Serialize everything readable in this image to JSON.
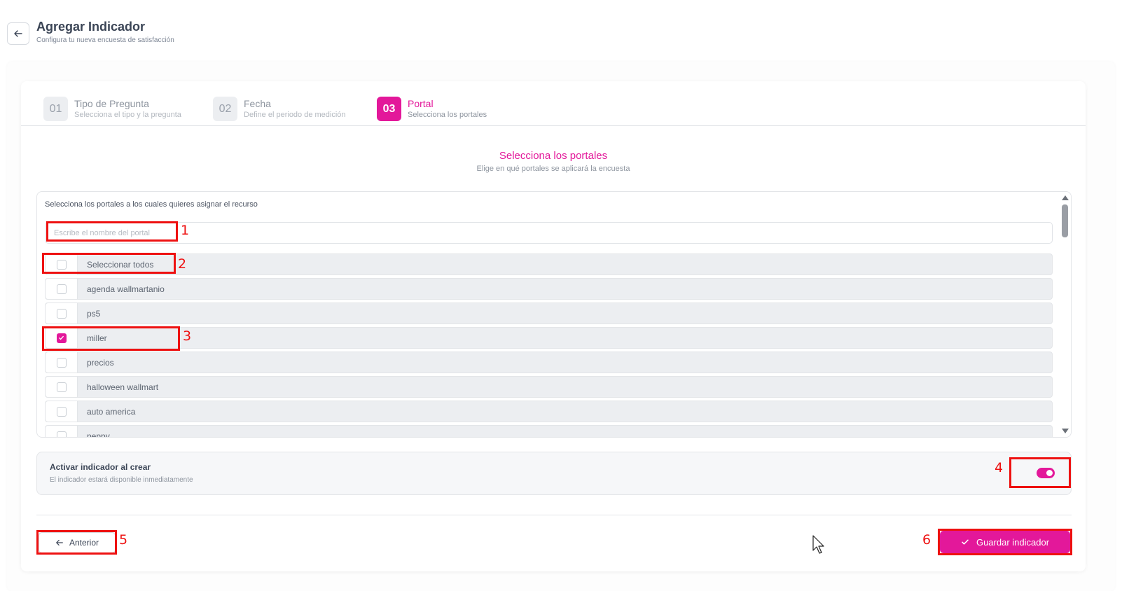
{
  "header": {
    "title": "Agregar Indicador",
    "subtitle": "Configura tu nueva encuesta de satisfacción"
  },
  "stepper": [
    {
      "number": "01",
      "title": "Tipo de Pregunta",
      "description": "Selecciona el tipo y la pregunta",
      "active": false
    },
    {
      "number": "02",
      "title": "Fecha",
      "description": "Define el periodo de medición",
      "active": false
    },
    {
      "number": "03",
      "title": "Portal",
      "description": "Selecciona los portales",
      "active": true
    }
  ],
  "section": {
    "title": "Selecciona los portales",
    "subtitle": "Elige en qué portales se aplicará la encuesta"
  },
  "portals": {
    "label": "Selecciona los portales a los cuales quieres asignar el recurso",
    "search_placeholder": "Escribe el nombre del portal",
    "select_all_label": "Seleccionar todos",
    "select_all_checked": false,
    "items": [
      {
        "name": "agenda wallmartanio",
        "checked": false
      },
      {
        "name": "ps5",
        "checked": false
      },
      {
        "name": "miller",
        "checked": true
      },
      {
        "name": "precios",
        "checked": false
      },
      {
        "name": "halloween wallmart",
        "checked": false
      },
      {
        "name": "auto america",
        "checked": false
      },
      {
        "name": "peppy",
        "checked": false
      }
    ]
  },
  "activation": {
    "title": "Activar indicador al crear",
    "description": "El indicador estará disponible inmediatamente",
    "enabled": true
  },
  "footer": {
    "prev_label": "Anterior",
    "save_label": "Guardar indicador"
  },
  "annotations": [
    "1",
    "2",
    "3",
    "4",
    "5",
    "6"
  ],
  "colors": {
    "accent": "#e3189a",
    "annotation": "#ee1111"
  },
  "icons": {
    "back": "arrow-left-icon",
    "prev": "arrow-left-icon",
    "save": "check-icon",
    "checkbox": "check-icon"
  }
}
